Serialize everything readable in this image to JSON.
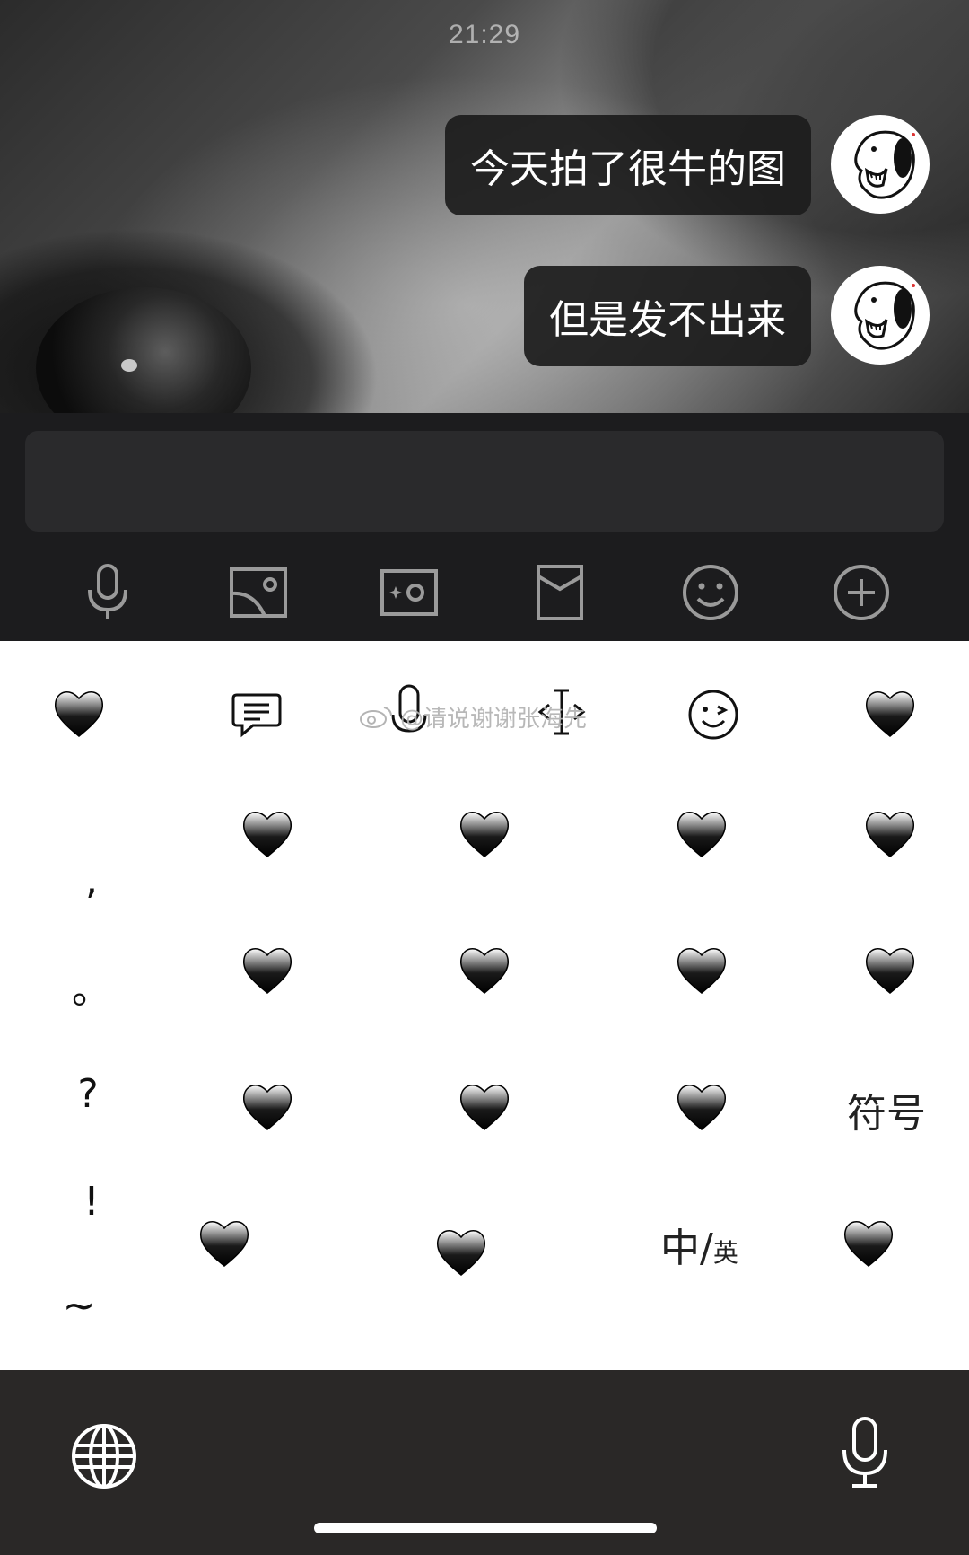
{
  "status": {
    "time": "21:29"
  },
  "messages": [
    {
      "text": "今天拍了很牛的图"
    },
    {
      "text": "但是发不出来"
    }
  ],
  "input": {
    "value": "",
    "placeholder": ""
  },
  "toolbar_icons": [
    "microphone-icon",
    "photo-album-icon",
    "camera-icon",
    "red-packet-icon",
    "emoji-icon",
    "plus-icon"
  ],
  "keyboard": {
    "top_row_icons": [
      "black-heart-icon",
      "message-icon",
      "microphone-icon",
      "cursor-icon",
      "wink-face-icon",
      "black-heart-icon"
    ],
    "punctuation": [
      ",",
      "。",
      "?",
      "!",
      "~"
    ],
    "symbols_label": "符号",
    "lang_main": "中/",
    "lang_sub": "英",
    "key_icon": "black-heart-icon"
  },
  "watermark": {
    "text": "@请说谢谢张海先",
    "icon": "weibo-icon"
  },
  "system_bar": {
    "left_icon": "globe-icon",
    "right_icon": "microphone-icon"
  }
}
